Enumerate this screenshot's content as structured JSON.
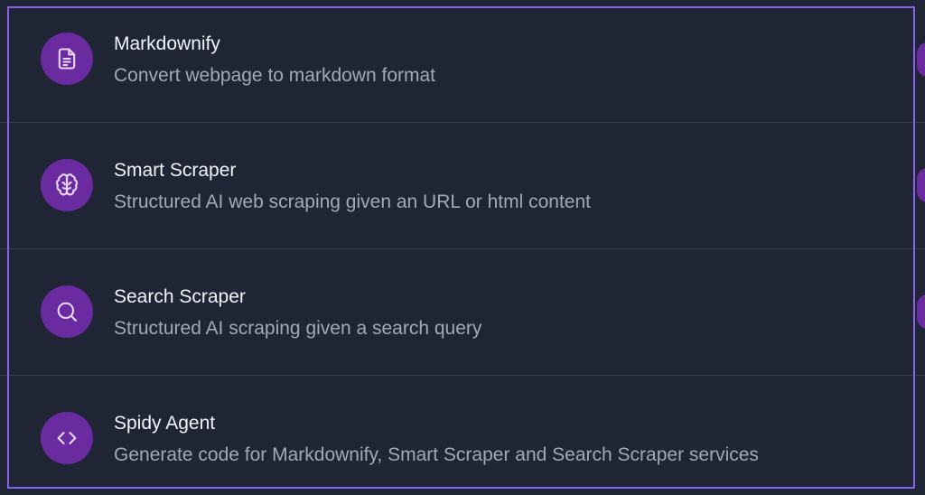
{
  "colors": {
    "background": "#1f2535",
    "border_accent": "#8a62e8",
    "icon_bg": "#6a2aa0",
    "title_text": "#f2f4f8",
    "desc_text": "#a3a9b6"
  },
  "items": [
    {
      "icon": "document-icon",
      "title": "Markdownify",
      "description": "Convert webpage to markdown format"
    },
    {
      "icon": "brain-icon",
      "title": "Smart Scraper",
      "description": "Structured AI web scraping given an URL or html content"
    },
    {
      "icon": "search-icon",
      "title": "Search Scraper",
      "description": "Structured AI scraping given a search query"
    },
    {
      "icon": "code-icon",
      "title": "Spidy Agent",
      "description": "Generate code for Markdownify, Smart Scraper and Search Scraper services"
    }
  ]
}
